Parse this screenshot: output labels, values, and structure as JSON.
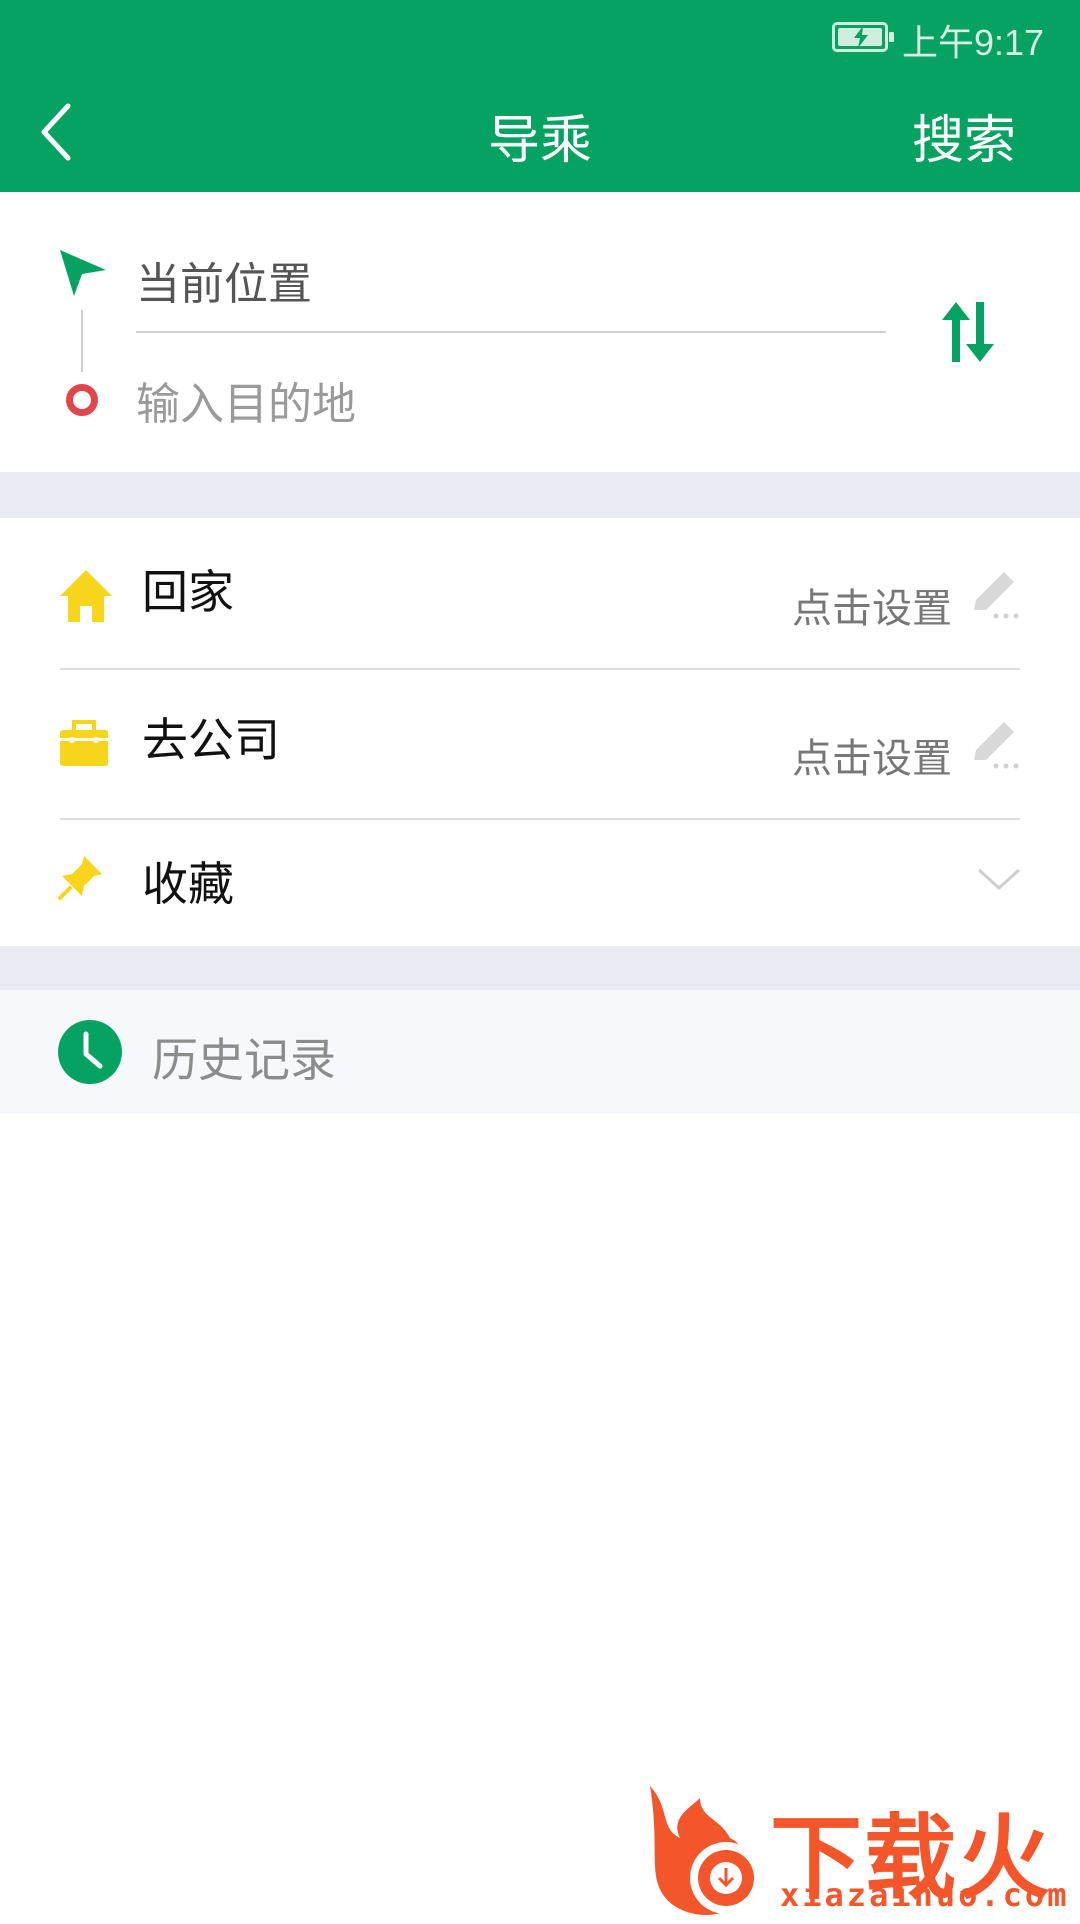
{
  "status_bar": {
    "time": "上午9:17"
  },
  "header": {
    "title": "导乘",
    "search_label": "搜索"
  },
  "route": {
    "start_value": "当前位置",
    "end_placeholder": "输入目的地"
  },
  "quick_list": {
    "home": {
      "label": "回家",
      "action": "点击设置"
    },
    "work": {
      "label": "去公司",
      "action": "点击设置"
    },
    "favorites": {
      "label": "收藏"
    }
  },
  "history": {
    "label": "历史记录"
  },
  "watermark": {
    "title": "下载火",
    "url": "xiazaihuo.com"
  },
  "colors": {
    "brand_green": "#06a262",
    "destination_red": "#e0464b",
    "icon_yellow": "#f7d51d",
    "watermark_orange": "#f4562b"
  },
  "icons": [
    "back-icon",
    "swap-icon",
    "navigation-arrow-icon",
    "destination-dot-icon",
    "home-icon",
    "briefcase-icon",
    "pin-icon",
    "pencil-icon",
    "chevron-down-icon",
    "clock-icon",
    "battery-icon"
  ]
}
